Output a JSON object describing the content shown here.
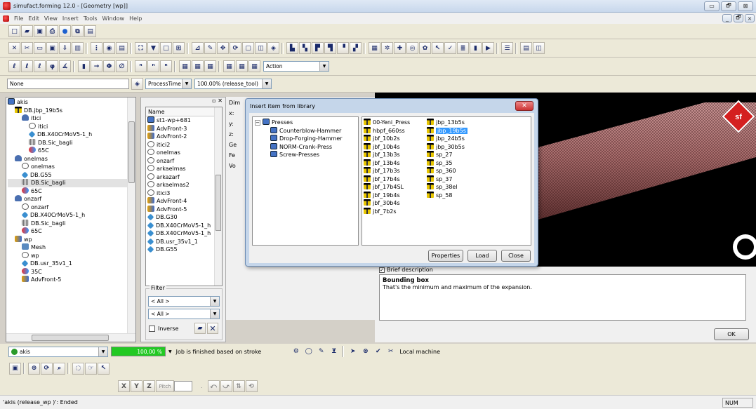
{
  "window": {
    "title": "simufact.forming 12.0 - [Geometry [wp]]",
    "minimize": "▭",
    "maximize": "🗗",
    "close": "⊠",
    "child_min": "_",
    "child_restore": "🗗",
    "child_close": "×"
  },
  "menu": [
    "File",
    "Edit",
    "View",
    "Insert",
    "Tools",
    "Window",
    "Help"
  ],
  "toolbar": {
    "action_combo": "Action",
    "none_field": "None",
    "process_combo": "ProcessTime %",
    "scale_combo": "100.00% (release_tool)"
  },
  "tree": [
    {
      "label": "akis",
      "indent": 0,
      "icon": "process"
    },
    {
      "label": "DB.jbp_19b5s",
      "indent": 1,
      "icon": "press"
    },
    {
      "label": "itici",
      "indent": 2,
      "icon": "object"
    },
    {
      "label": "itici",
      "indent": 3,
      "icon": "cylinder"
    },
    {
      "label": "DB.X40CrMoV5-1_h",
      "indent": 3,
      "icon": "material"
    },
    {
      "label": "DB.Sic_bagli",
      "indent": 3,
      "icon": "friction"
    },
    {
      "label": "65C",
      "indent": 3,
      "icon": "temperature"
    },
    {
      "label": "onelmas",
      "indent": 1,
      "icon": "object"
    },
    {
      "label": "onelmas",
      "indent": 2,
      "icon": "cylinder"
    },
    {
      "label": "DB.G55",
      "indent": 2,
      "icon": "material"
    },
    {
      "label": "DB.Sic_bagli",
      "indent": 2,
      "icon": "friction",
      "selected": true
    },
    {
      "label": "65C",
      "indent": 2,
      "icon": "temperature"
    },
    {
      "label": "onzarf",
      "indent": 1,
      "icon": "object"
    },
    {
      "label": "onzarf",
      "indent": 2,
      "icon": "cylinder"
    },
    {
      "label": "DB.X40CrMoV5-1_h",
      "indent": 2,
      "icon": "material"
    },
    {
      "label": "DB.Sic_bagli",
      "indent": 2,
      "icon": "friction"
    },
    {
      "label": "65C",
      "indent": 2,
      "icon": "temperature"
    },
    {
      "label": "wp",
      "indent": 1,
      "icon": "workpiece"
    },
    {
      "label": "Mesh",
      "indent": 2,
      "icon": "mesh"
    },
    {
      "label": "wp",
      "indent": 2,
      "icon": "cylinder"
    },
    {
      "label": "DB.usr_35v1_1",
      "indent": 2,
      "icon": "material"
    },
    {
      "label": "35C",
      "indent": 2,
      "icon": "temperature"
    },
    {
      "label": "AdvFront-5",
      "indent": 2,
      "icon": "advfront"
    }
  ],
  "library": {
    "column_header": "Name",
    "items": [
      {
        "label": "st1-wp+681",
        "icon": "screen"
      },
      {
        "label": "AdvFront-3",
        "icon": "advfront"
      },
      {
        "label": "AdvFront-2",
        "icon": "advfront"
      },
      {
        "label": "itici2",
        "icon": "cylinder"
      },
      {
        "label": "onelmas",
        "icon": "cylinder"
      },
      {
        "label": "onzarf",
        "icon": "cylinder"
      },
      {
        "label": "arkaelmas",
        "icon": "cylinder"
      },
      {
        "label": "arkazarf",
        "icon": "cylinder"
      },
      {
        "label": "arkaelmas2",
        "icon": "cylinder"
      },
      {
        "label": "itici3",
        "icon": "cylinder"
      },
      {
        "label": "AdvFront-4",
        "icon": "advfront"
      },
      {
        "label": "AdvFront-5",
        "icon": "advfront"
      },
      {
        "label": "DB.G30",
        "icon": "material"
      },
      {
        "label": "DB.X40CrMoV5-1_h",
        "icon": "material"
      },
      {
        "label": "DB.X40CrMoV5-1_h",
        "icon": "material"
      },
      {
        "label": "DB.usr_35v1_1",
        "icon": "material"
      },
      {
        "label": "DB.G55",
        "icon": "material"
      }
    ],
    "filter_label": "Filter",
    "filter1": "< All >",
    "filter2": "< All >",
    "inverse_label": "Inverse"
  },
  "props_labels": [
    "Dim",
    "x:",
    "y:",
    "z:",
    "Ge",
    "Fe",
    "Vo"
  ],
  "dialog": {
    "title": "Insert item from library",
    "root": "Presses",
    "tree": [
      "Counterblow-Hammer",
      "Drop-Forging-Hammer",
      "NORM-Crank-Press",
      "Screw-Presses"
    ],
    "col1": [
      "00-Yeni_Press",
      "hbpf_660ss",
      "jbf_10b2s",
      "jbf_10b4s",
      "jbf_13b3s",
      "jbf_13b4s",
      "jbf_17b3s",
      "jbf_17b4s",
      "jbf_17b4SL",
      "jbf_19b4s",
      "jbf_30b4s",
      "jbf_7b2s"
    ],
    "col2": [
      "jbp_13b5s",
      "jbp_19b5s",
      "jbp_24b5s",
      "jbp_30b5s",
      "sp_27",
      "sp_35",
      "sp_360",
      "sp_37",
      "sp_38el",
      "sp_58"
    ],
    "selected": "jbp_19b5s",
    "buttons": {
      "properties": "Properties",
      "load": "Load",
      "close": "Close"
    }
  },
  "description": {
    "toggle": "Brief description",
    "heading": "Bounding box",
    "text": "That's the minimum and maximum of the expansion."
  },
  "ok_button": "OK",
  "bottom": {
    "process_combo": "akis",
    "progress_text": "100,00 %",
    "progress": 1.0,
    "job_status": "Job is finished based on stroke",
    "machine": "Local machine",
    "x_btn": "X",
    "y_btn": "Y",
    "z_btn": "Z",
    "pitch_label": "Pitch"
  },
  "status": {
    "text": "'akis (release_wp )': Ended",
    "num": "NUM"
  },
  "colors": {
    "viewport_bg": "#000000",
    "cylinder": "#a06060",
    "selection": "#3399ff",
    "progress": "#22c922",
    "logo": "#d42020"
  }
}
